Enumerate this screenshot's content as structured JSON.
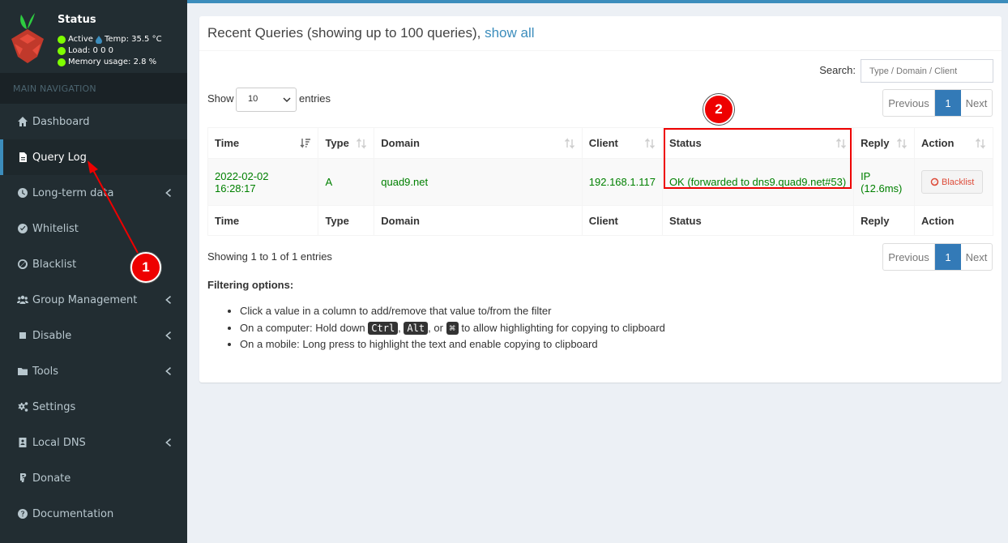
{
  "sidebar": {
    "status": {
      "title": "Status",
      "active": "Active",
      "temp": "Temp: 35.5 °C",
      "load": "Load:  0  0  0",
      "memory": "Memory usage:  2.8 %"
    },
    "nav_header": "MAIN NAVIGATION",
    "items": [
      {
        "label": "Dashboard",
        "icon": "home-icon"
      },
      {
        "label": "Query Log",
        "icon": "file-icon",
        "active": true
      },
      {
        "label": "Long-term data",
        "icon": "clock-icon",
        "submenu": true
      },
      {
        "label": "Whitelist",
        "icon": "check-circle-icon"
      },
      {
        "label": "Blacklist",
        "icon": "ban-icon"
      },
      {
        "label": "Group Management",
        "icon": "users-icon",
        "submenu": true
      },
      {
        "label": "Disable",
        "icon": "stop-icon",
        "submenu": true
      },
      {
        "label": "Tools",
        "icon": "folder-icon",
        "submenu": true
      },
      {
        "label": "Settings",
        "icon": "gears-icon"
      },
      {
        "label": "Local DNS",
        "icon": "address-book-icon",
        "submenu": true
      },
      {
        "label": "Donate",
        "icon": "paypal-icon"
      },
      {
        "label": "Documentation",
        "icon": "question-circle-icon"
      }
    ]
  },
  "main": {
    "title": "Recent Queries (showing up to 100 queries),",
    "show_all": "show all",
    "search_label": "Search:",
    "search_placeholder": "Type / Domain / Client",
    "show_label": "Show",
    "entries_value": "10",
    "entries_label": "entries",
    "pager": {
      "prev": "Previous",
      "current": "1",
      "next": "Next"
    },
    "columns": [
      "Time",
      "Type",
      "Domain",
      "Client",
      "Status",
      "Reply",
      "Action"
    ],
    "rows": [
      {
        "time": "2022-02-02 16:28:17",
        "type": "A",
        "domain": "quad9.net",
        "client": "192.168.1.117",
        "status": "OK (forwarded to dns9.quad9.net#53)",
        "reply_1": "IP",
        "reply_2": "(12.6ms)",
        "action": "Blacklist"
      }
    ],
    "showing": "Showing 1 to 1 of 1 entries",
    "filter_title": "Filtering options:",
    "filter_1": "Click a value in a column to add/remove that value to/from the filter",
    "filter_2_prefix": "On a computer: Hold down",
    "kbd_ctrl": "Ctrl",
    "kbd_alt": "Alt",
    "kbd_cmd": "⌘",
    "filter_2_or": ", or",
    "filter_2_suffix": "to allow highlighting for copying to clipboard",
    "filter_3": "On a mobile: Long press to highlight the text and enable copying to clipboard"
  },
  "annotations": {
    "badge_1": "1",
    "badge_2": "2",
    "color": "#ee0000"
  },
  "colors": {
    "sidebar_bg": "#222d32",
    "accent": "#3c8dbc",
    "ok_green": "#008000"
  }
}
